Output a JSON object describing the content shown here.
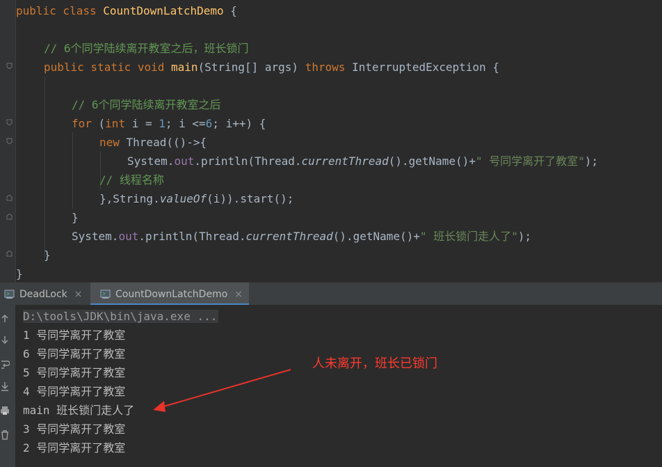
{
  "editor": {
    "line1": {
      "kw": "public class ",
      "name": "CountDownLatchDemo",
      "rest": " {"
    },
    "line2": {
      "comment": "// 6个同学陆续离开教室之后，班长锁门"
    },
    "line3": {
      "kw1": "public static void ",
      "name": "main",
      "p1": "(String[] ",
      "param": "args",
      "p2": ") ",
      "kw2": "throws",
      "rest": " InterruptedException {"
    },
    "line4": {
      "comment": "// 6个同学陆续离开教室之后"
    },
    "line5": {
      "kw": "for",
      "p1": " (",
      "kw2": "int",
      "p2": " i = ",
      "n1": "1",
      "p3": "; i <=",
      "n2": "6",
      "p4": "; i++) {"
    },
    "line6": {
      "kw": "new ",
      "cls": "Thread",
      "rest": "(()->{"
    },
    "line7": {
      "cls": "System",
      "dot1": ".",
      "field": "out",
      "dot2": ".",
      "method": "println",
      "p1": "(",
      "cls2": "Thread",
      "dot3": ".",
      "m2": "currentThread",
      "p2": "().",
      "m3": "getName",
      "p3": "()+",
      "str": "\" 号同学离开了教室\"",
      "end": ");"
    },
    "line8": {
      "comment": "// 线程名称"
    },
    "line9": {
      "p1": "},",
      "cls": "String",
      "dot": ".",
      "method": "valueOf",
      "p2": "(i)).",
      "m2": "start",
      "p3": "();"
    },
    "line10": {
      "text": "}"
    },
    "line11": {
      "cls": "System",
      "dot1": ".",
      "field": "out",
      "dot2": ".",
      "method": "println",
      "p1": "(",
      "cls2": "Thread",
      "dot3": ".",
      "m2": "currentThread",
      "p2": "().",
      "m3": "getName",
      "p3": "()+",
      "str": "\" 班长锁门走人了\"",
      "end": ");"
    },
    "line12": {
      "text": "}"
    },
    "line13": {
      "text": "}"
    }
  },
  "run_tabs": [
    {
      "label": "DeadLock",
      "close": "×"
    },
    {
      "label": "CountDownLatchDemo",
      "close": "×"
    }
  ],
  "console": {
    "command": "D:\\tools\\JDK\\bin\\java.exe ...",
    "lines": [
      "1 号同学离开了教室",
      "6 号同学离开了教室",
      "5 号同学离开了教室",
      "4 号同学离开了教室",
      "main 班长锁门走人了",
      "3 号同学离开了教室",
      "2 号同学离开了教室"
    ]
  },
  "annotation": {
    "text": "人未离开，班长已锁门",
    "color": "#ff3b2f"
  },
  "colors": {
    "background": "#2b2b2b",
    "keyword": "#cc7832",
    "comment": "#629755",
    "string": "#6a8759",
    "number": "#6897bb",
    "field": "#9876aa",
    "method": "#ffc66d",
    "tab_accent": "#4a88c7"
  }
}
